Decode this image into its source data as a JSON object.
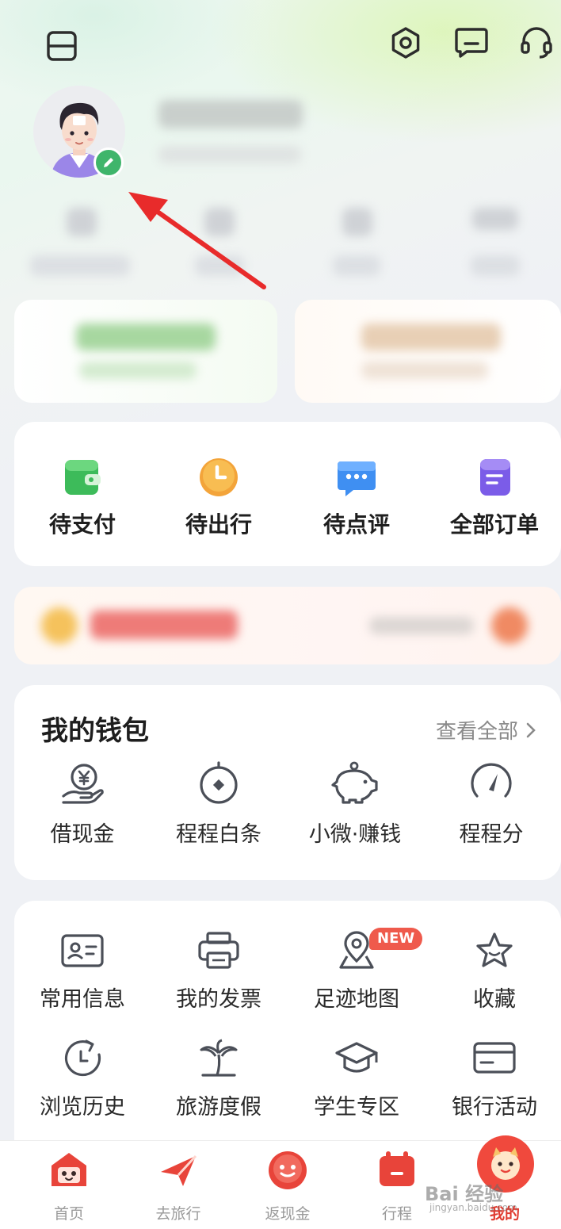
{
  "header": {
    "icons": [
      "scan-icon",
      "settings-icon",
      "message-icon",
      "customer-service-icon"
    ]
  },
  "orders": {
    "items": [
      {
        "label": "待支付",
        "icon": "wallet-icon"
      },
      {
        "label": "待出行",
        "icon": "clock-icon"
      },
      {
        "label": "待点评",
        "icon": "comment-icon"
      },
      {
        "label": "全部订单",
        "icon": "orders-icon"
      }
    ]
  },
  "wallet": {
    "title": "我的钱包",
    "view_all": "查看全部",
    "items": [
      {
        "label": "借现金",
        "icon": "cash-hand-icon"
      },
      {
        "label": "程程白条",
        "icon": "credit-icon"
      },
      {
        "label": "小微·赚钱",
        "icon": "piggy-bank-icon"
      },
      {
        "label": "程程分",
        "icon": "gauge-icon"
      }
    ]
  },
  "services": {
    "new_badge": "NEW",
    "items": [
      {
        "label": "常用信息",
        "icon": "id-card-icon"
      },
      {
        "label": "我的发票",
        "icon": "printer-icon"
      },
      {
        "label": "足迹地图",
        "icon": "map-pin-icon"
      },
      {
        "label": "收藏",
        "icon": "star-icon"
      },
      {
        "label": "浏览历史",
        "icon": "history-icon"
      },
      {
        "label": "旅游度假",
        "icon": "palm-tree-icon"
      },
      {
        "label": "学生专区",
        "icon": "graduation-cap-icon"
      },
      {
        "label": "银行活动",
        "icon": "bank-card-icon"
      }
    ]
  },
  "tabbar": {
    "items": [
      {
        "label": "首页",
        "icon": "home-icon"
      },
      {
        "label": "去旅行",
        "icon": "plane-icon"
      },
      {
        "label": "返现金",
        "icon": "cashback-icon"
      },
      {
        "label": "行程",
        "icon": "trip-icon"
      },
      {
        "label": "我的",
        "icon": "profile-mascot-icon"
      }
    ],
    "active_index": 4
  },
  "colors": {
    "accent": "#e8443a",
    "active_tab": "#e03b30",
    "muted": "#8a8a8a",
    "badge": "#ef5a4c",
    "edit_badge": "#3fb56b"
  },
  "watermark": {
    "text": "Bai 经验",
    "sub": "jingyan.baidu.com"
  }
}
